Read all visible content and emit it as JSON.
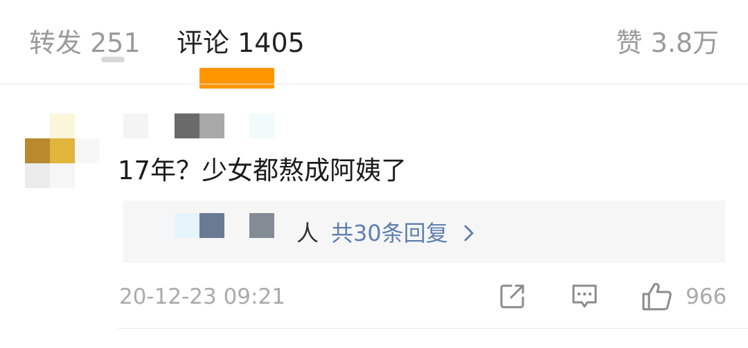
{
  "tabs": {
    "repost": {
      "label": "转发",
      "count": "251"
    },
    "comments": {
      "label": "评论",
      "count": "1405"
    },
    "likes": {
      "label": "赞",
      "count": "3.8万"
    }
  },
  "colors": {
    "accent": "#FF9600",
    "link": "#5D7FB0",
    "muted": "#AAAAAA"
  },
  "comment": {
    "text": "17年？少女都熬成阿姨了",
    "reply_person_fragment": "人",
    "reply_summary": "共30条回复",
    "reply_chevron": "chevron-right-icon",
    "timestamp": "20-12-23 09:21",
    "actions": {
      "share_icon": "share-icon",
      "reply_icon": "comment-icon",
      "like_icon": "thumbs-up-icon",
      "like_count": "966"
    }
  }
}
